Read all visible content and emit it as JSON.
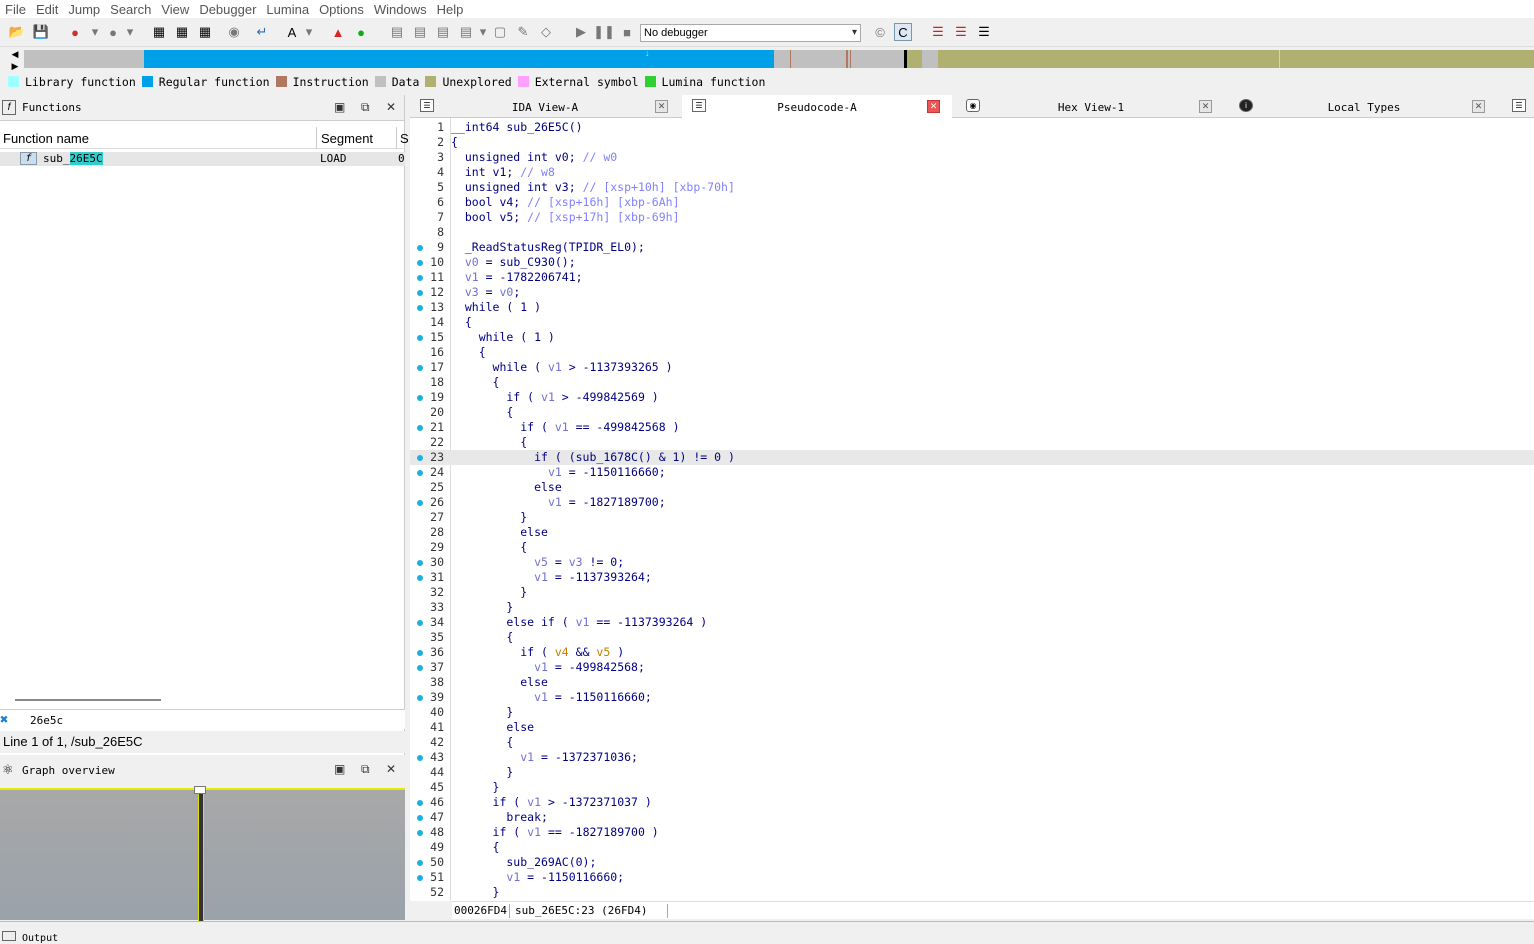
{
  "menu": [
    "File",
    "Edit",
    "Jump",
    "Search",
    "View",
    "Debugger",
    "Lumina",
    "Options",
    "Windows",
    "Help"
  ],
  "toolbar": {
    "debugger_value": "No debugger"
  },
  "legend": [
    {
      "label": "Library function",
      "color": "#a0ffff"
    },
    {
      "label": "Regular function",
      "color": "#00a0e8"
    },
    {
      "label": "Instruction",
      "color": "#b07860"
    },
    {
      "label": "Data",
      "color": "#c0c0c0"
    },
    {
      "label": "Unexplored",
      "color": "#b0b070"
    },
    {
      "label": "External symbol",
      "color": "#ffa0ff"
    },
    {
      "label": "Lumina function",
      "color": "#30d030"
    }
  ],
  "functions_panel": {
    "title": "Functions",
    "col_name": "Function name",
    "col_segment": "Segment",
    "col_extra": "S",
    "row": {
      "name_prefix": "sub_",
      "name_hl": "26E5C",
      "segment": "LOAD",
      "extra": "0"
    },
    "filter": "26e5c",
    "status": "Line 1 of 1, /sub_26E5C"
  },
  "graph_panel": {
    "title": "Graph overview"
  },
  "tabs": [
    {
      "label": "IDA View-A",
      "active": false
    },
    {
      "label": "Pseudocode-A",
      "active": true
    },
    {
      "label": "Hex View-1",
      "active": false
    },
    {
      "label": "Local Types",
      "active": false
    }
  ],
  "code_status": {
    "addr": "00026FD4",
    "loc": "sub_26E5C:23 (26FD4)"
  },
  "output": {
    "label": "Output"
  },
  "code": [
    {
      "n": "1",
      "dot": false,
      "html": "<span class='k'>__int64 sub_26E5C()</span>"
    },
    {
      "n": "2",
      "dot": false,
      "html": "{"
    },
    {
      "n": "3",
      "dot": false,
      "html": "  unsigned int <span class='k'>v0</span>; <span class='c'>// w0</span>"
    },
    {
      "n": "4",
      "dot": false,
      "html": "  int v1; <span class='c'>// w8</span>"
    },
    {
      "n": "5",
      "dot": false,
      "html": "  unsigned int v3; <span class='c'>// [xsp+10h] [xbp-70h]</span>"
    },
    {
      "n": "6",
      "dot": false,
      "html": "  bool v4; <span class='c'>// [xsp+16h] [xbp-6Ah]</span>"
    },
    {
      "n": "7",
      "dot": false,
      "html": "  bool v5; <span class='c'>// [xsp+17h] [xbp-69h]</span>"
    },
    {
      "n": "8",
      "dot": false,
      "html": ""
    },
    {
      "n": "9",
      "dot": true,
      "html": "  _ReadStatusReg(TPIDR_EL0);"
    },
    {
      "n": "10",
      "dot": true,
      "html": "  <span class='v'>v0</span> = sub_C930();"
    },
    {
      "n": "11",
      "dot": true,
      "html": "  <span class='v'>v1</span> = -1782206741;"
    },
    {
      "n": "12",
      "dot": true,
      "html": "  <span class='v'>v3</span> = <span class='v'>v0</span>;"
    },
    {
      "n": "13",
      "dot": true,
      "html": "  while ( 1 )"
    },
    {
      "n": "14",
      "dot": false,
      "html": "  {"
    },
    {
      "n": "15",
      "dot": true,
      "html": "    while ( 1 )"
    },
    {
      "n": "16",
      "dot": false,
      "html": "    {"
    },
    {
      "n": "17",
      "dot": true,
      "html": "      while ( <span class='v'>v1</span> > -1137393265 )"
    },
    {
      "n": "18",
      "dot": false,
      "html": "      {"
    },
    {
      "n": "19",
      "dot": true,
      "html": "        if ( <span class='v'>v1</span> > -499842569 )"
    },
    {
      "n": "20",
      "dot": false,
      "html": "        {"
    },
    {
      "n": "21",
      "dot": true,
      "html": "          if ( <span class='v'>v1</span> == -499842568 )"
    },
    {
      "n": "22",
      "dot": false,
      "html": "          {"
    },
    {
      "n": "23",
      "dot": true,
      "html": "            if ( (sub_1678C() &amp; 1) != 0 )",
      "current": true
    },
    {
      "n": "24",
      "dot": true,
      "html": "              <span class='v'>v1</span> = -1150116660;"
    },
    {
      "n": "25",
      "dot": false,
      "html": "            else"
    },
    {
      "n": "26",
      "dot": true,
      "html": "              <span class='v'>v1</span> = -1827189700;"
    },
    {
      "n": "27",
      "dot": false,
      "html": "          }"
    },
    {
      "n": "28",
      "dot": false,
      "html": "          else"
    },
    {
      "n": "29",
      "dot": false,
      "html": "          {"
    },
    {
      "n": "30",
      "dot": true,
      "html": "            <span class='v'>v5</span> = <span class='v'>v3</span> != 0;"
    },
    {
      "n": "31",
      "dot": true,
      "html": "            <span class='v'>v1</span> = -1137393264;"
    },
    {
      "n": "32",
      "dot": false,
      "html": "          }"
    },
    {
      "n": "33",
      "dot": false,
      "html": "        }"
    },
    {
      "n": "34",
      "dot": true,
      "html": "        else if ( <span class='v'>v1</span> == -1137393264 )"
    },
    {
      "n": "35",
      "dot": false,
      "html": "        {"
    },
    {
      "n": "36",
      "dot": true,
      "html": "          if ( <span class='y'>v4</span> &amp;&amp; <span class='y'>v5</span> )"
    },
    {
      "n": "37",
      "dot": true,
      "html": "            <span class='v'>v1</span> = -499842568;"
    },
    {
      "n": "38",
      "dot": false,
      "html": "          else"
    },
    {
      "n": "39",
      "dot": true,
      "html": "            <span class='v'>v1</span> = -1150116660;"
    },
    {
      "n": "40",
      "dot": false,
      "html": "        }"
    },
    {
      "n": "41",
      "dot": false,
      "html": "        else"
    },
    {
      "n": "42",
      "dot": false,
      "html": "        {"
    },
    {
      "n": "43",
      "dot": true,
      "html": "          <span class='v'>v1</span> = -1372371036;"
    },
    {
      "n": "44",
      "dot": false,
      "html": "        }"
    },
    {
      "n": "45",
      "dot": false,
      "html": "      }"
    },
    {
      "n": "46",
      "dot": true,
      "html": "      if ( <span class='v'>v1</span> > -1372371037 )"
    },
    {
      "n": "47",
      "dot": true,
      "html": "        break;"
    },
    {
      "n": "48",
      "dot": true,
      "html": "      if ( <span class='v'>v1</span> == -1827189700 )"
    },
    {
      "n": "49",
      "dot": false,
      "html": "      {"
    },
    {
      "n": "50",
      "dot": true,
      "html": "        sub_269AC(0);"
    },
    {
      "n": "51",
      "dot": true,
      "html": "        <span class='v'>v1</span> = -1150116660;"
    },
    {
      "n": "52",
      "dot": false,
      "html": "      }"
    }
  ]
}
